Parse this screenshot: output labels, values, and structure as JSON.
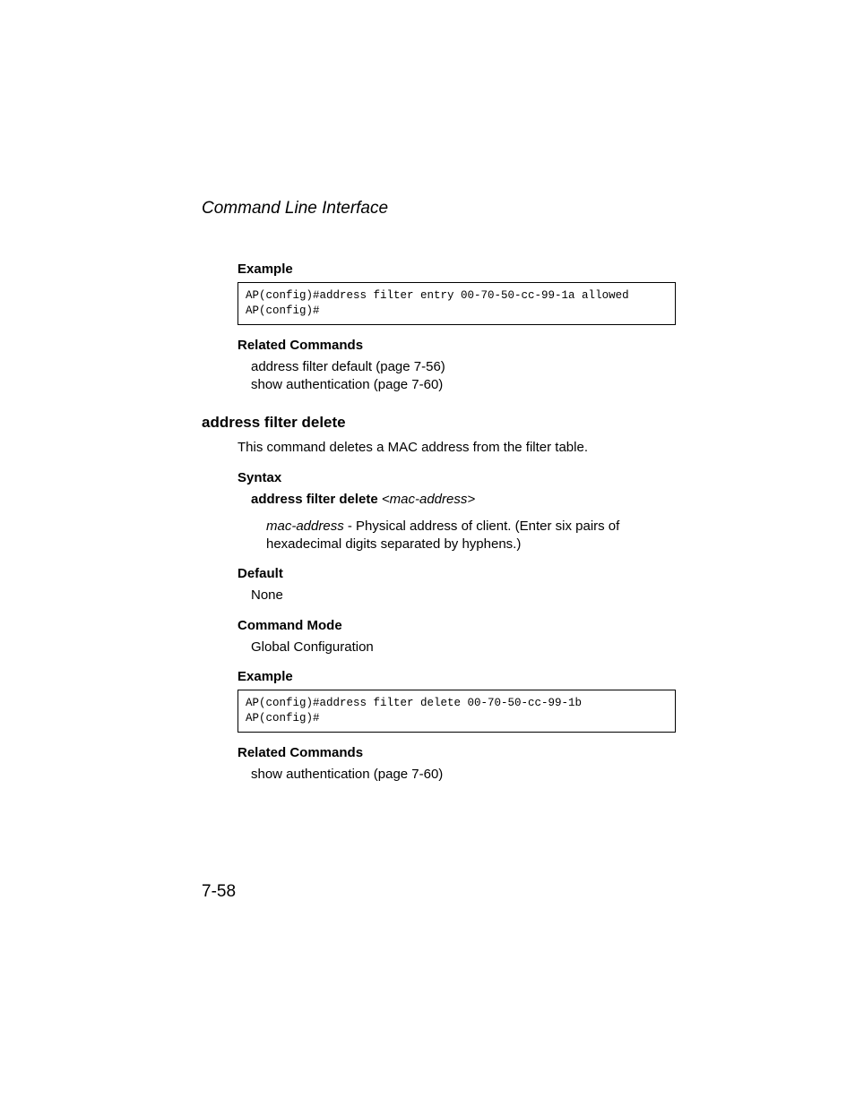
{
  "chapter_title": "Command Line Interface",
  "s1": {
    "example_heading": "Example",
    "example_code": "AP(config)#address filter entry 00-70-50-cc-99-1a allowed\nAP(config)#",
    "related_heading": "Related Commands",
    "related_1": "address filter default (page 7-56)",
    "related_2": "show authentication (page 7-60)"
  },
  "cmd": {
    "title": "address filter delete",
    "description": "This command deletes a MAC address from the filter table.",
    "syntax_heading": "Syntax",
    "syntax_cmd": "address filter delete",
    "syntax_arg": "<mac-address>",
    "param_name": "mac-address",
    "param_desc": " - Physical address of client. (Enter six pairs of hexadecimal digits separated by hyphens.)",
    "default_heading": "Default",
    "default_value": "None",
    "mode_heading": "Command Mode",
    "mode_value": "Global Configuration",
    "example_heading": "Example",
    "example_code": "AP(config)#address filter delete 00-70-50-cc-99-1b\nAP(config)#",
    "related_heading": "Related Commands",
    "related_1": "show authentication (page 7-60)"
  },
  "page_number": "7-58"
}
